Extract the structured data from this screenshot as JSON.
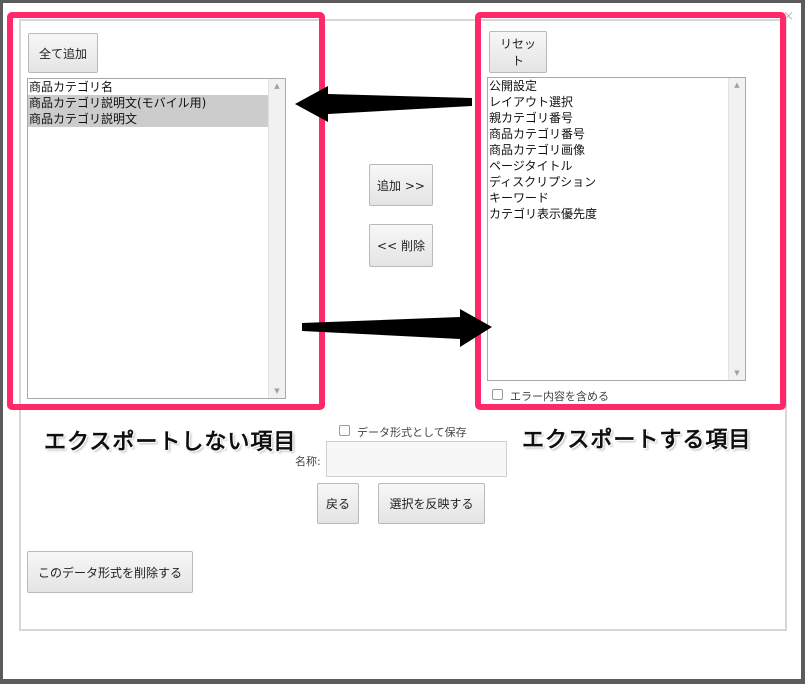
{
  "left_panel": {
    "add_all_button": "全て追加",
    "items": [
      {
        "label": "商品カテゴリ名",
        "selected": false
      },
      {
        "label": "商品カテゴリ説明文(モバイル用)",
        "selected": true
      },
      {
        "label": "商品カテゴリ説明文",
        "selected": true
      }
    ],
    "caption": "エクスポートしない項目"
  },
  "middle": {
    "add_button": "追加 >>",
    "remove_button": "<< 削除"
  },
  "right_panel": {
    "reset_button": "リセット",
    "items": [
      {
        "label": "公開設定"
      },
      {
        "label": "レイアウト選択"
      },
      {
        "label": "親カテゴリ番号"
      },
      {
        "label": "商品カテゴリ番号"
      },
      {
        "label": "商品カテゴリ画像"
      },
      {
        "label": "ページタイトル"
      },
      {
        "label": "ディスクリプション"
      },
      {
        "label": "キーワード"
      },
      {
        "label": "カテゴリ表示優先度"
      }
    ],
    "include_errors_label": "エラー内容を含める",
    "caption": "エクスポートする項目"
  },
  "save_section": {
    "save_as_format_label": "データ形式として保存",
    "name_label": "名称:",
    "name_value": "",
    "back_button": "戻る",
    "apply_button": "選択を反映する"
  },
  "delete_format_button": "このデータ形式を削除する",
  "close_glyph": "×",
  "colors": {
    "annotation_border": "#ff2868",
    "overlay": "#5b5b5b",
    "arrow": "#000000"
  }
}
